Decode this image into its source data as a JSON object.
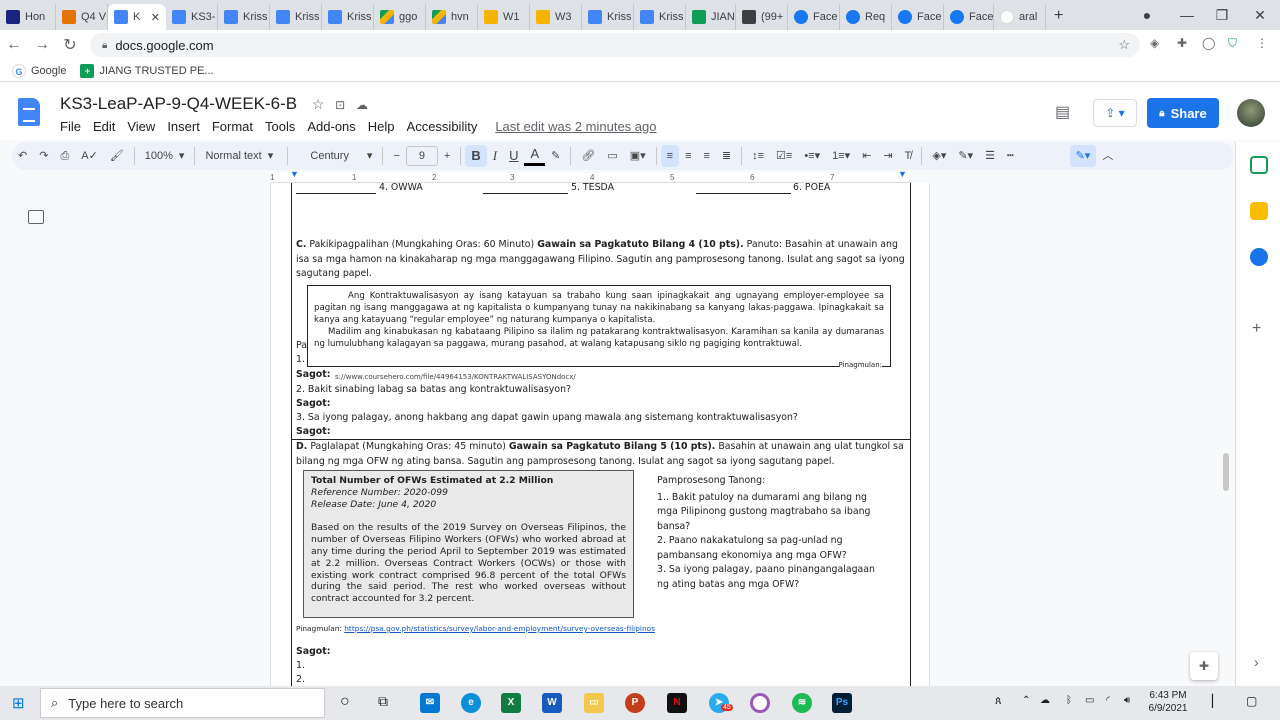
{
  "browser": {
    "tabs": [
      {
        "label": "Hon",
        "icon": "fav-navy"
      },
      {
        "label": "Q4 V",
        "icon": "fav-orange"
      },
      {
        "label": "K",
        "icon": "fav-doc",
        "active": true
      },
      {
        "label": "KS3-",
        "icon": "fav-doc"
      },
      {
        "label": "Kriss",
        "icon": "fav-doc"
      },
      {
        "label": "Kriss",
        "icon": "fav-doc"
      },
      {
        "label": "Kriss",
        "icon": "fav-doc"
      },
      {
        "label": "ggo",
        "icon": "fav-drive"
      },
      {
        "label": "hvn",
        "icon": "fav-drive"
      },
      {
        "label": "W1",
        "icon": "fav-slides"
      },
      {
        "label": "W3",
        "icon": "fav-slides"
      },
      {
        "label": "Kriss",
        "icon": "fav-doc"
      },
      {
        "label": "Kriss",
        "icon": "fav-doc"
      },
      {
        "label": "JIAN",
        "icon": "fav-sheet"
      },
      {
        "label": "(99+",
        "icon": "fav-dark"
      },
      {
        "label": "Face",
        "icon": "fav-fb"
      },
      {
        "label": "Req",
        "icon": "fav-fb"
      },
      {
        "label": "Face",
        "icon": "fav-fb"
      },
      {
        "label": "Face",
        "icon": "fav-fb"
      },
      {
        "label": "aral",
        "icon": "fav-g"
      }
    ],
    "url": "docs.google.com",
    "bookmarks": [
      {
        "label": "Google"
      },
      {
        "label": "JIANG TRUSTED PE..."
      }
    ]
  },
  "docs": {
    "title": "KS3-LeaP-AP-9-Q4-WEEK-6-B",
    "menu": [
      "File",
      "Edit",
      "View",
      "Insert",
      "Format",
      "Tools",
      "Add-ons",
      "Help",
      "Accessibility"
    ],
    "last_edit": "Last edit was 2 minutes ago",
    "share_label": "Share",
    "toolbar": {
      "zoom": "100%",
      "style": "Normal text",
      "font": "Century Go...",
      "font_size": "9"
    },
    "ruler_numbers": [
      "1",
      "1",
      "2",
      "3",
      "4",
      "5",
      "6",
      "7"
    ]
  },
  "content": {
    "top_row": [
      "4. OWWA",
      "5. TESDA",
      "6. POEA"
    ],
    "section_c": {
      "letter": "C.",
      "intro_plain": " Pakikipagpalihan (Mungkahing Oras: 60 Minuto) ",
      "intro_bold": "Gawain sa Pagkatuto Bilang 4 (10 pts).",
      "intro_rest": " Panuto: Basahin at unawain ang isa sa mga hamon na kinakaharap ng mga manggagawang Filipino. Sagutin ang pamprosesong tanong. Isulat ang sagot sa iyong sagutang papel.",
      "quote_p1": "Ang Kontraktuwalisasyon ay isang katayuan sa trabaho kung saan ipinagkakait ang ugnayang employer-employee sa pagitan ng isang manggagawa at ng kapitalista o kumpanyang tunay na nakikinabang sa kanyang lakas-paggawa. Ipinagkakait sa kanya ang katayuang “regular employee” ng naturang kumpanya o kapitalista.",
      "quote_p2": "Madilim ang kinabukasan ng kabataang Pilipino sa ilalim ng patakarang kontraktwalisasyon. Karamihan sa kanila ay dumaranas ng lumulubhang kalagayan sa paggawa, murang pasahod, at walang katapusang siklo ng pagiging kontraktuwal.",
      "quote_source": "Pinagmulan:",
      "hidden_pa": "Pa",
      "hidden_1": "1.",
      "sagot": "Sagot:",
      "link_fragment": "s://www.coursehero.com/file/44964153/KONTRAKTWALISASYONdocx/",
      "q2": "2. Bakit sinabing labag sa batas ang kontraktuwalisasyon?",
      "q3": "3. Sa iyong palagay, anong hakbang ang dapat gawin upang mawala ang sistemang kontraktuwalisasyon?"
    },
    "section_d": {
      "letter": "D.",
      "intro_plain": " Paglalapat (Mungkahing Oras: 45 minuto) ",
      "intro_bold": "Gawain sa Pagkatuto Bilang 5 (10 pts).",
      "intro_rest": " Basahin at unawain ang ulat tungkol sa bilang ng mga OFW ng ating bansa. Sagutin ang pamprosesong tanong. Isulat ang sagot sa iyong sagutang papel.",
      "report_title": "Total Number of OFWs Estimated at 2.2 Million",
      "report_ref": "Reference Number: 2020-099",
      "report_date": "Release Date: June 4, 2020",
      "report_body": "Based on the results of the 2019 Survey on Overseas Filipinos, the number of Overseas Filipino Workers (OFWs) who worked abroad at any time during the period April to September 2019 was estimated at 2.2 million. Overseas Contract Workers (OCWs) or those with existing work contract comprised 96.8 percent of the total OFWs during the said period. The rest who worked overseas without contract accounted for 3.2 percent.",
      "questions_heading": "Pamprosesong Tanong:",
      "questions": [
        "1.. Bakit patuloy na dumarami ang bilang ng mga Pilipinong gustong magtrabaho sa ibang bansa?",
        "2. Paano nakakatulong sa pag-unlad ng pambansang ekonomiya ang mga OFW?",
        "3. Sa iyong palagay, paano pinangangalagaan ng ating batas ang mga OFW?"
      ],
      "source_label": "Pinagmulan: ",
      "source_url": "https://psa.gov.ph/statistics/survey/labor-and-employment/survey-overseas-filipinos",
      "sagot": "Sagot:",
      "answer_lines": [
        "1.",
        "2."
      ]
    }
  },
  "taskbar": {
    "search_placeholder": "Type here to search",
    "time": "6:43 PM",
    "date": "6/9/2021",
    "badge": "45"
  }
}
